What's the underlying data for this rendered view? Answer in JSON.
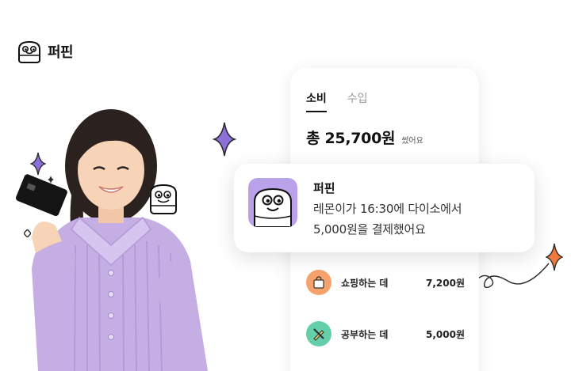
{
  "brand": {
    "name": "퍼핀",
    "logo_icon": "puffin-logo-icon"
  },
  "phone": {
    "tabs": [
      {
        "label": "소비",
        "active": true
      },
      {
        "label": "수입",
        "active": false
      }
    ],
    "total": {
      "amount": "총 25,700원",
      "suffix": "썼어요"
    },
    "categories": [
      {
        "name": "쇼핑하는 데",
        "amount": "7,200원",
        "icon": "shopping-bag-icon",
        "color": "#f6a26d"
      },
      {
        "name": "공부하는 데",
        "amount": "5,000원",
        "icon": "pencil-ruler-icon",
        "color": "#64cfa8"
      }
    ]
  },
  "notification": {
    "app_name": "퍼핀",
    "message_line1": "레몬이가 16:30에 다이소에서",
    "message_line2": "5,000원을 결제했어요",
    "icon": "puffin-app-icon",
    "icon_bg": "#b9a2ea"
  },
  "colors": {
    "sparkle_purple": "#8c6fd8",
    "sparkle_orange": "#f07a3c",
    "sweater_lavender": "#c4aee3"
  }
}
